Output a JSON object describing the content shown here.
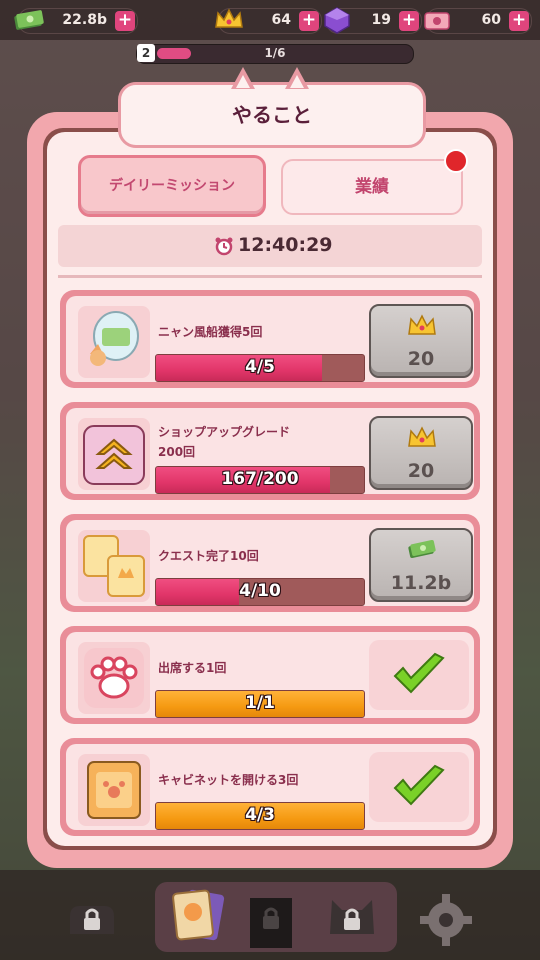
{
  "resources": {
    "cash": "22.8b",
    "crowns": "64",
    "gems": "19",
    "tickets": "60"
  },
  "level": {
    "number": "2",
    "progress": "1/6"
  },
  "modal": {
    "title": "やること",
    "tabs": {
      "daily": "デイリーミッション",
      "achievements": "業績"
    },
    "timer": "12:40:29",
    "missions": [
      {
        "label_lines": [
          "ニャン風船獲得5回"
        ],
        "progress": "4/5",
        "fill": 0.8,
        "reward": "20",
        "reward_icon": "crown-icon",
        "claimed": false,
        "icon": "balloon-icon"
      },
      {
        "label_lines": [
          "ショップアップグレード",
          "200回"
        ],
        "progress": "167/200",
        "fill": 0.835,
        "reward": "20",
        "reward_icon": "crown-icon",
        "claimed": false,
        "icon": "upgrade-arrows-icon"
      },
      {
        "label_lines": [
          "クエスト完了10回"
        ],
        "progress": "4/10",
        "fill": 0.4,
        "reward": "11.2b",
        "reward_icon": "cash-icon",
        "claimed": false,
        "icon": "quest-cards-icon"
      },
      {
        "label_lines": [
          "出席する1回"
        ],
        "progress": "1/1",
        "fill": 1.0,
        "reward": "",
        "reward_icon": "check-icon",
        "claimed": true,
        "icon": "paw-icon"
      },
      {
        "label_lines": [
          "キャビネットを開ける3回"
        ],
        "progress": "4/3",
        "fill": 1.0,
        "reward": "",
        "reward_icon": "check-icon",
        "claimed": true,
        "icon": "cabinet-icon"
      }
    ]
  },
  "colors": {
    "accent_pink": "#e13569",
    "complete_orange": "#f59a12",
    "frame_pink": "#f2a7ad"
  }
}
